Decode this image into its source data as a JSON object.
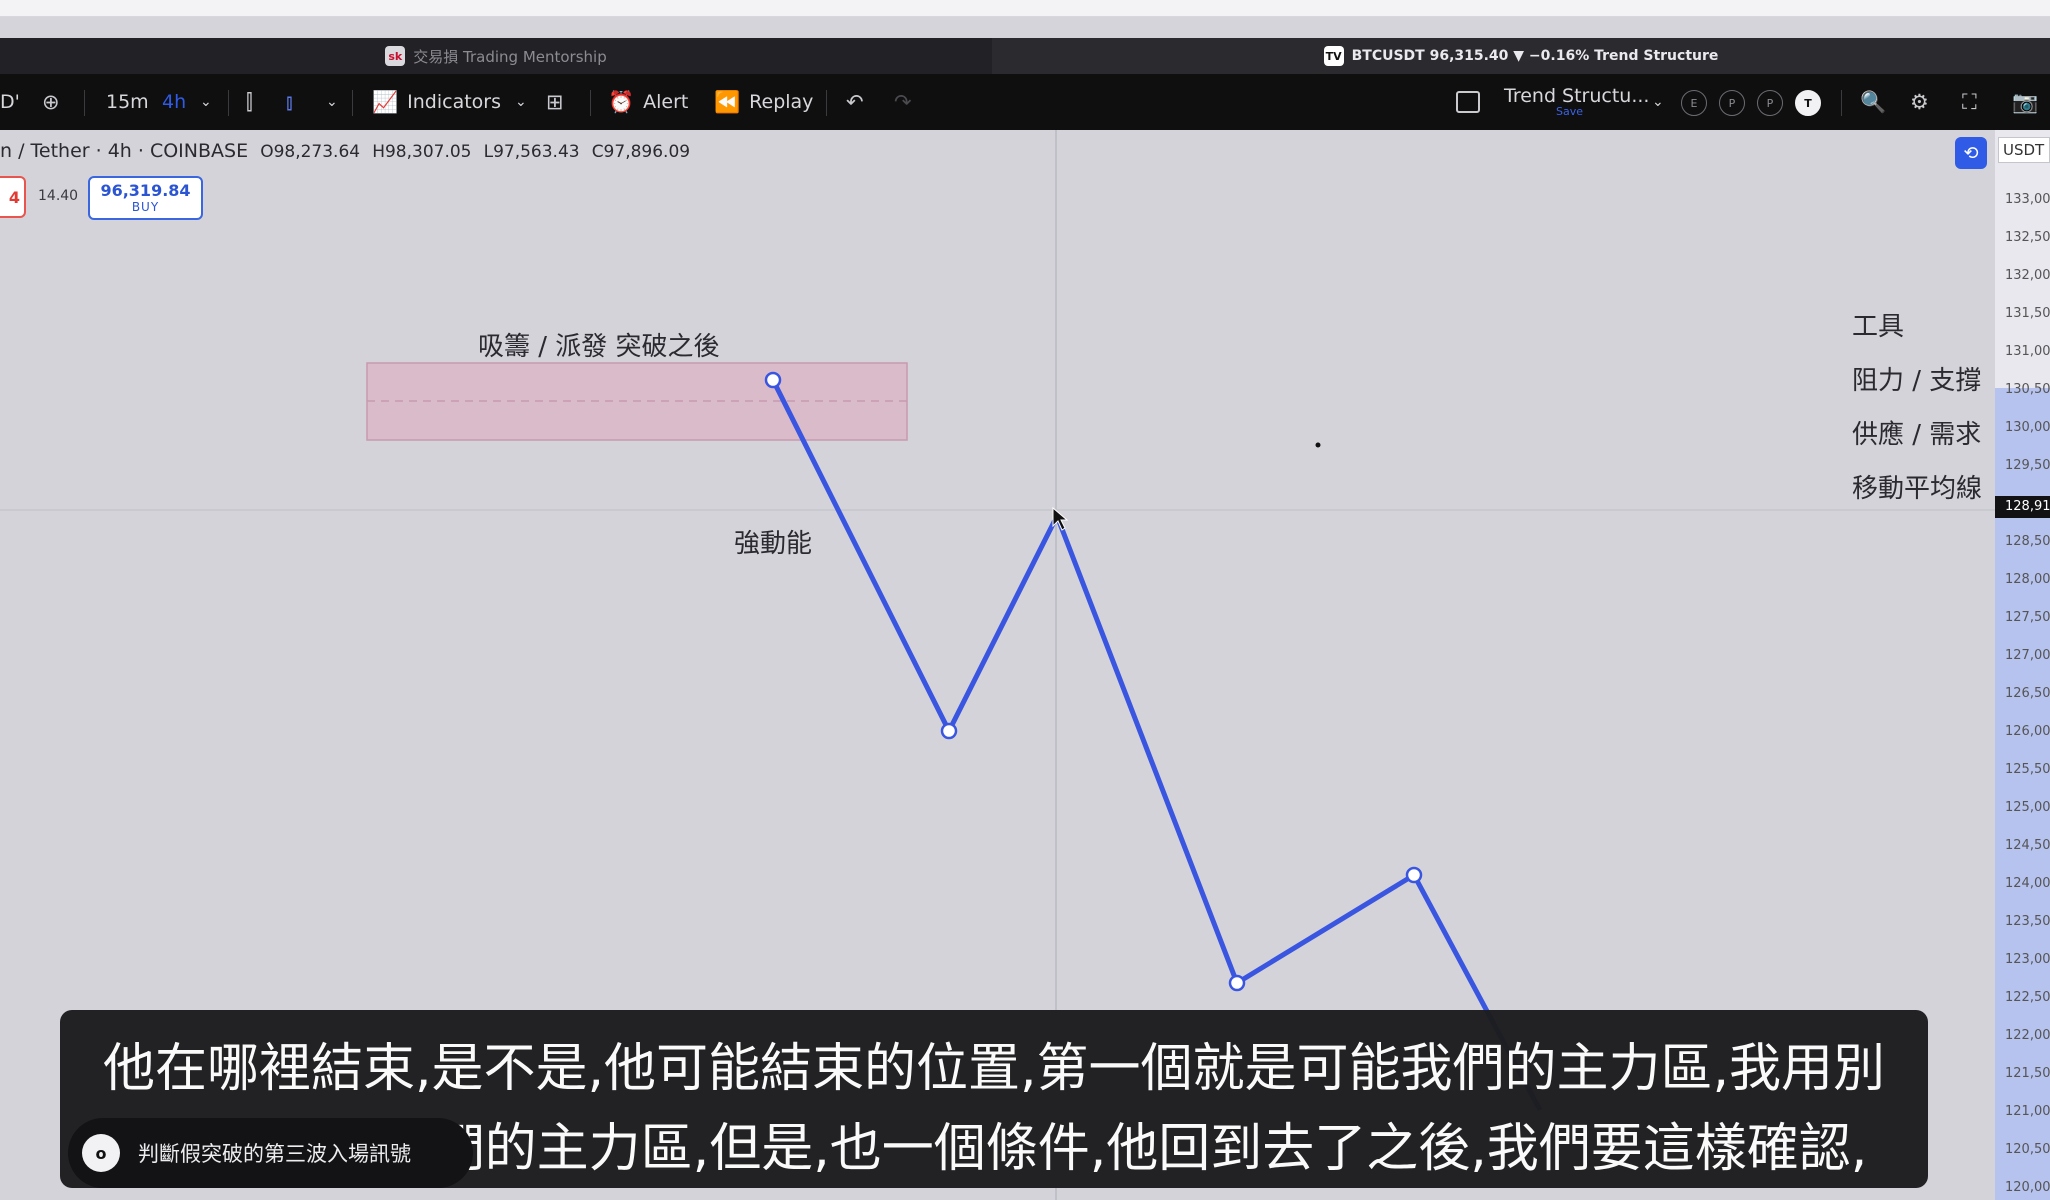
{
  "browser_tabs": [
    {
      "logo": "sk",
      "title": "交易損 Trading Mentorship",
      "active": false
    },
    {
      "logo": "TV",
      "title": "BTCUSDT 96,315.40 ▼ −0.16% Trend Structure",
      "active": true
    }
  ],
  "toolbar": {
    "symbol_fragment": "D'",
    "add_icon": "plus-circle-icon",
    "interval_active": "15m",
    "interval_alt": "4h",
    "indicators_label": "Indicators",
    "alert_label": "Alert",
    "replay_label": "Replay",
    "layout_name": "Trend Structu...",
    "layout_status": "Save",
    "badges": [
      "E",
      "P",
      "P"
    ],
    "avatar_letter": "T"
  },
  "legend": {
    "title": "n / Tether · 4h · COINBASE",
    "open": "O98,273.64",
    "high": "H98,307.05",
    "low": "L97,563.43",
    "close": "C97,896.09"
  },
  "order_panel": {
    "sell_fragment": "4",
    "spread": "14.40",
    "buy_price": "96,319.84",
    "buy_label": "BUY"
  },
  "annotations": {
    "zone_label": "吸籌 / 派發 突破之後",
    "momentum_label": "強動能"
  },
  "side_menu": [
    "工具",
    "阻力 / 支撐",
    "供應 / 需求",
    "移動平均線"
  ],
  "price_axis": {
    "currency": "USDT",
    "current_label": "128,91",
    "ticks": [
      "133,00",
      "132,50",
      "132,00",
      "131,50",
      "131,00",
      "130,50",
      "130,00",
      "129,50",
      "128,50",
      "128,00",
      "127,50",
      "127,00",
      "126,50",
      "126,00",
      "125,50",
      "125,00",
      "124,50",
      "124,00",
      "123,50",
      "123,00",
      "122,50",
      "122,00",
      "121,50",
      "121,00",
      "120,50",
      "120,00"
    ]
  },
  "subtitles": {
    "line1": "他在哪裡結束,是不是,他可能結束的位置,第一個就是可能我們的主力區,我用別",
    "line2": "的顏色的是我們的主力區,但是,也一個條件,他回到去了之後,我們要這樣確認,"
  },
  "chapter": {
    "marker": "o",
    "title": "判斷假突破的第三波入場訊號"
  },
  "colors": {
    "zigzag": "#3a55e0",
    "zone_fill": "#d9b6c7",
    "zone_border": "#c79aaf",
    "axis_highlight": "#b7c3ef",
    "accent": "#2f5be6"
  }
}
